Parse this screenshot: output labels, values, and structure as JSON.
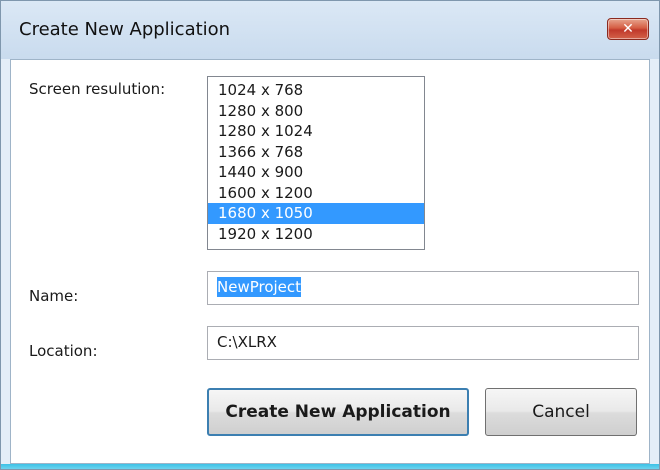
{
  "window": {
    "title": "Create New Application",
    "close_glyph": "✕",
    "close_icon": "close-icon"
  },
  "resolution": {
    "label": "Screen resulution:",
    "options": [
      "1024 x 768",
      "1280 x 800",
      "1280 x 1024",
      "1366 x 768",
      "1440 x 900",
      "1600 x 1200",
      "1680 x 1050",
      "1920 x 1200"
    ],
    "selected": "1680 x 1050"
  },
  "name": {
    "label": "Name:",
    "value": "NewProject"
  },
  "location": {
    "label": "Location:",
    "value": "C:\\XLRX"
  },
  "buttons": {
    "create_label": "Create New Application",
    "cancel_label": "Cancel"
  },
  "colors": {
    "selection": "#3399ff",
    "close_button": "#c0392b"
  }
}
